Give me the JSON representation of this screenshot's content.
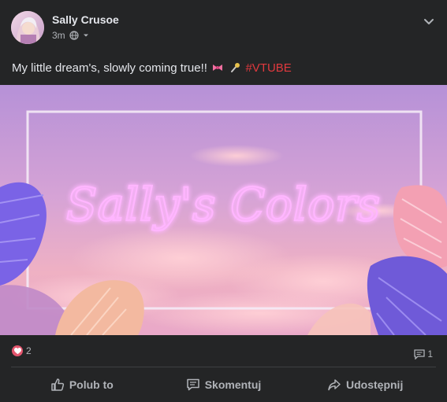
{
  "post": {
    "author": "Sally Crusoe",
    "timestamp": "3m",
    "caption_text": "My little dream's, slowly coming true!!",
    "caption_hashtag": "#VTUBE",
    "media_title": "Sally's Colors",
    "reactions_count": "2",
    "comments_count": "1"
  },
  "actions": {
    "like": "Polub to",
    "comment": "Skomentuj",
    "share": "Udostępnij"
  },
  "colors": {
    "background": "#242526",
    "text_primary": "#e4e6eb",
    "text_secondary": "#b0b3b8",
    "hashtag": "#e0393e",
    "reaction_heart": "#e4566e"
  },
  "icons": [
    "globe-icon",
    "audience-caret-icon",
    "more-options-icon",
    "ribbon-emoji",
    "microphone-emoji",
    "heart-reaction-icon",
    "comment-count-icon",
    "like-icon",
    "comment-icon",
    "share-icon"
  ]
}
